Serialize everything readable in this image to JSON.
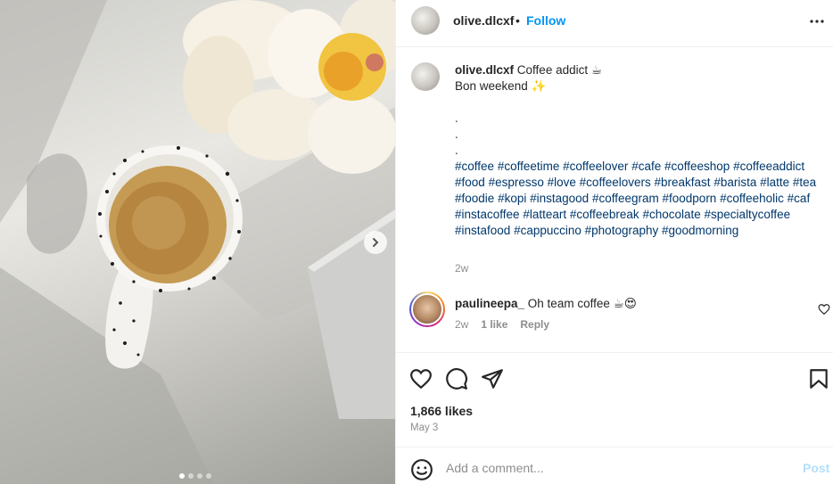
{
  "post": {
    "username": "olive.dlcxf",
    "separator": "•",
    "follow_label": "Follow",
    "more_icon": "more-horizontal-icon"
  },
  "caption": {
    "username": "olive.dlcxf",
    "line1": "Coffee addict",
    "line1_emoji": "☕",
    "line2": "Bon weekend",
    "line2_emoji": "✨",
    "dot1": ".",
    "dot2": ".",
    "dot3": ".",
    "hashtags": [
      "#coffee",
      "#coffeetime",
      "#coffeelover",
      "#cafe",
      "#coffeeshop",
      "#coffeeaddict",
      "#food",
      "#espresso",
      "#love",
      "#coffeelovers",
      "#breakfast",
      "#barista",
      "#latte",
      "#tea",
      "#foodie",
      "#kopi",
      "#instagood",
      "#coffeegram",
      "#foodporn",
      "#coffeeholic",
      "#caf",
      "#instacoffee",
      "#latteart",
      "#coffeebreak",
      "#chocolate",
      "#specialtycoffee",
      "#instafood",
      "#cappuccino",
      "#photography",
      "#goodmorning"
    ],
    "time": "2w"
  },
  "comment": {
    "username": "paulineepa_",
    "text": "Oh team coffee",
    "emoji": "☕😍",
    "time": "2w",
    "likes": "1 like",
    "reply_label": "Reply"
  },
  "stats": {
    "likes": "1,866 likes",
    "date": "May 3"
  },
  "composer": {
    "placeholder": "Add a comment...",
    "post_label": "Post"
  },
  "carousel": {
    "slides": 4,
    "active": 0
  },
  "colors": {
    "follow": "#0095f6",
    "hashtag": "#00376b",
    "meta": "#8e8e8e",
    "post_disabled": "#b2dffc"
  }
}
